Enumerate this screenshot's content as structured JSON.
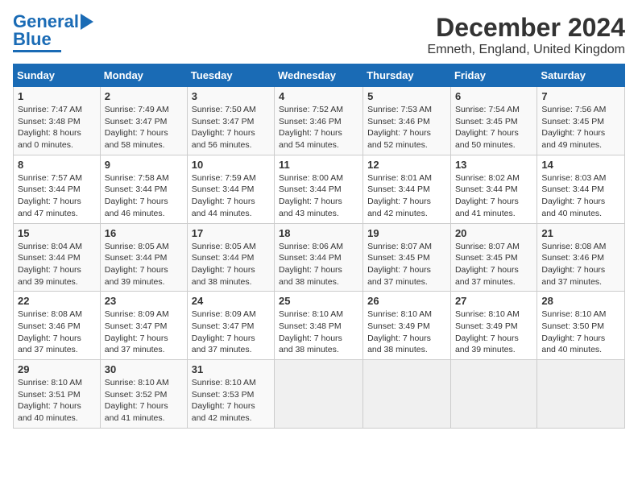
{
  "header": {
    "logo_general": "General",
    "logo_blue": "Blue",
    "title": "December 2024",
    "subtitle": "Emneth, England, United Kingdom"
  },
  "days_of_week": [
    "Sunday",
    "Monday",
    "Tuesday",
    "Wednesday",
    "Thursday",
    "Friday",
    "Saturday"
  ],
  "weeks": [
    [
      {
        "day": "1",
        "info": "Sunrise: 7:47 AM\nSunset: 3:48 PM\nDaylight: 8 hours\nand 0 minutes."
      },
      {
        "day": "2",
        "info": "Sunrise: 7:49 AM\nSunset: 3:47 PM\nDaylight: 7 hours\nand 58 minutes."
      },
      {
        "day": "3",
        "info": "Sunrise: 7:50 AM\nSunset: 3:47 PM\nDaylight: 7 hours\nand 56 minutes."
      },
      {
        "day": "4",
        "info": "Sunrise: 7:52 AM\nSunset: 3:46 PM\nDaylight: 7 hours\nand 54 minutes."
      },
      {
        "day": "5",
        "info": "Sunrise: 7:53 AM\nSunset: 3:46 PM\nDaylight: 7 hours\nand 52 minutes."
      },
      {
        "day": "6",
        "info": "Sunrise: 7:54 AM\nSunset: 3:45 PM\nDaylight: 7 hours\nand 50 minutes."
      },
      {
        "day": "7",
        "info": "Sunrise: 7:56 AM\nSunset: 3:45 PM\nDaylight: 7 hours\nand 49 minutes."
      }
    ],
    [
      {
        "day": "8",
        "info": "Sunrise: 7:57 AM\nSunset: 3:44 PM\nDaylight: 7 hours\nand 47 minutes."
      },
      {
        "day": "9",
        "info": "Sunrise: 7:58 AM\nSunset: 3:44 PM\nDaylight: 7 hours\nand 46 minutes."
      },
      {
        "day": "10",
        "info": "Sunrise: 7:59 AM\nSunset: 3:44 PM\nDaylight: 7 hours\nand 44 minutes."
      },
      {
        "day": "11",
        "info": "Sunrise: 8:00 AM\nSunset: 3:44 PM\nDaylight: 7 hours\nand 43 minutes."
      },
      {
        "day": "12",
        "info": "Sunrise: 8:01 AM\nSunset: 3:44 PM\nDaylight: 7 hours\nand 42 minutes."
      },
      {
        "day": "13",
        "info": "Sunrise: 8:02 AM\nSunset: 3:44 PM\nDaylight: 7 hours\nand 41 minutes."
      },
      {
        "day": "14",
        "info": "Sunrise: 8:03 AM\nSunset: 3:44 PM\nDaylight: 7 hours\nand 40 minutes."
      }
    ],
    [
      {
        "day": "15",
        "info": "Sunrise: 8:04 AM\nSunset: 3:44 PM\nDaylight: 7 hours\nand 39 minutes."
      },
      {
        "day": "16",
        "info": "Sunrise: 8:05 AM\nSunset: 3:44 PM\nDaylight: 7 hours\nand 39 minutes."
      },
      {
        "day": "17",
        "info": "Sunrise: 8:05 AM\nSunset: 3:44 PM\nDaylight: 7 hours\nand 38 minutes."
      },
      {
        "day": "18",
        "info": "Sunrise: 8:06 AM\nSunset: 3:44 PM\nDaylight: 7 hours\nand 38 minutes."
      },
      {
        "day": "19",
        "info": "Sunrise: 8:07 AM\nSunset: 3:45 PM\nDaylight: 7 hours\nand 37 minutes."
      },
      {
        "day": "20",
        "info": "Sunrise: 8:07 AM\nSunset: 3:45 PM\nDaylight: 7 hours\nand 37 minutes."
      },
      {
        "day": "21",
        "info": "Sunrise: 8:08 AM\nSunset: 3:46 PM\nDaylight: 7 hours\nand 37 minutes."
      }
    ],
    [
      {
        "day": "22",
        "info": "Sunrise: 8:08 AM\nSunset: 3:46 PM\nDaylight: 7 hours\nand 37 minutes."
      },
      {
        "day": "23",
        "info": "Sunrise: 8:09 AM\nSunset: 3:47 PM\nDaylight: 7 hours\nand 37 minutes."
      },
      {
        "day": "24",
        "info": "Sunrise: 8:09 AM\nSunset: 3:47 PM\nDaylight: 7 hours\nand 37 minutes."
      },
      {
        "day": "25",
        "info": "Sunrise: 8:10 AM\nSunset: 3:48 PM\nDaylight: 7 hours\nand 38 minutes."
      },
      {
        "day": "26",
        "info": "Sunrise: 8:10 AM\nSunset: 3:49 PM\nDaylight: 7 hours\nand 38 minutes."
      },
      {
        "day": "27",
        "info": "Sunrise: 8:10 AM\nSunset: 3:49 PM\nDaylight: 7 hours\nand 39 minutes."
      },
      {
        "day": "28",
        "info": "Sunrise: 8:10 AM\nSunset: 3:50 PM\nDaylight: 7 hours\nand 40 minutes."
      }
    ],
    [
      {
        "day": "29",
        "info": "Sunrise: 8:10 AM\nSunset: 3:51 PM\nDaylight: 7 hours\nand 40 minutes."
      },
      {
        "day": "30",
        "info": "Sunrise: 8:10 AM\nSunset: 3:52 PM\nDaylight: 7 hours\nand 41 minutes."
      },
      {
        "day": "31",
        "info": "Sunrise: 8:10 AM\nSunset: 3:53 PM\nDaylight: 7 hours\nand 42 minutes."
      },
      {
        "day": "",
        "info": ""
      },
      {
        "day": "",
        "info": ""
      },
      {
        "day": "",
        "info": ""
      },
      {
        "day": "",
        "info": ""
      }
    ]
  ]
}
